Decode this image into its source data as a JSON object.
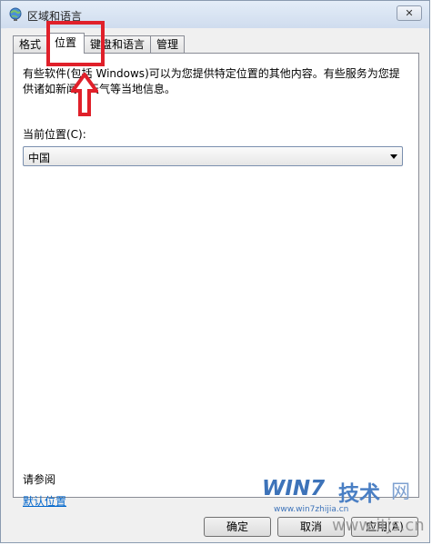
{
  "window": {
    "title": "区域和语言",
    "close_glyph": "✕"
  },
  "tabs": [
    {
      "label": "格式",
      "active": false
    },
    {
      "label": "位置",
      "active": true
    },
    {
      "label": "键盘和语言",
      "active": false
    },
    {
      "label": "管理",
      "active": false
    }
  ],
  "location_tab": {
    "description": "有些软件(包括 Windows)可以为您提供特定位置的其他内容。有些服务为您提供诸如新闻和天气等当地信息。",
    "current_location_label": "当前位置(C):",
    "current_location_value": "中国",
    "see_also_label": "请参阅",
    "default_location_link": "默认位置"
  },
  "buttons": {
    "ok": "确定",
    "cancel": "取消",
    "apply": "应用(A)"
  },
  "watermark": {
    "brand_win7": "WIN7",
    "brand_jishu": "技术",
    "brand_wang": "网",
    "url1": "www.win7zhijia.cn",
    "url2": "www.itjs.cn"
  },
  "colors": {
    "annotation_red": "#e0202a",
    "link_blue": "#0066cc",
    "watermark_blue": "#3d73b9"
  }
}
